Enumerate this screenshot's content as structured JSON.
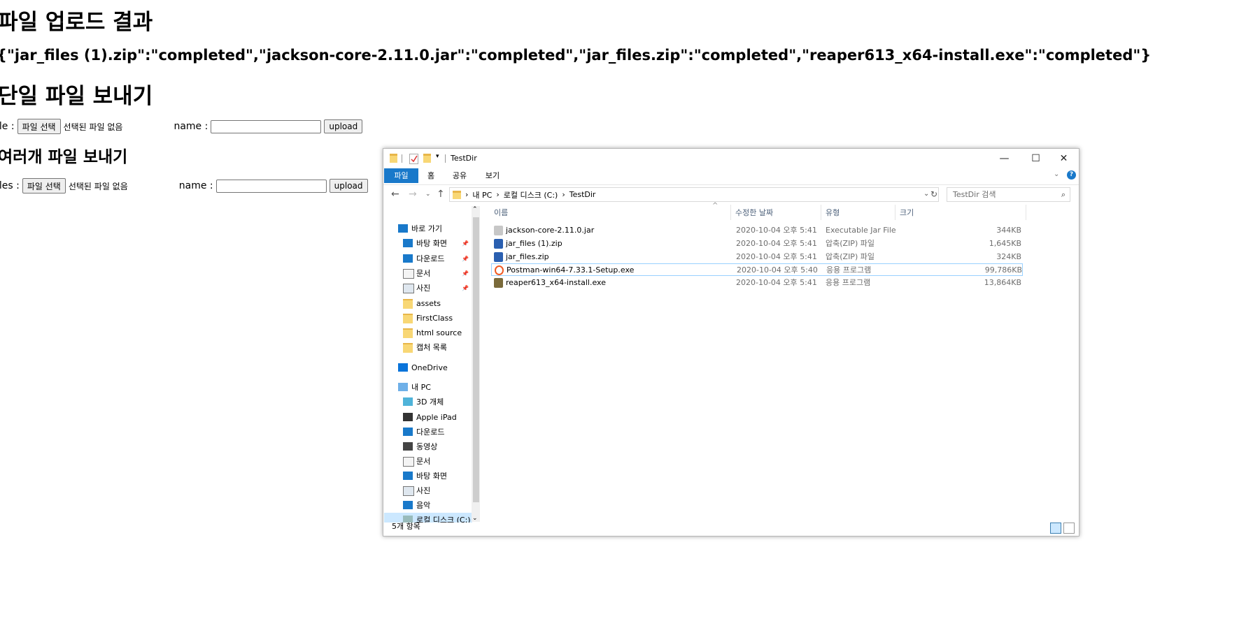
{
  "page": {
    "result_heading": "파일 업로드 결과",
    "result_json": "{\"jar_files (1).zip\":\"completed\",\"jackson-core-2.11.0.jar\":\"completed\",\"jar_files.zip\":\"completed\",\"reaper613_x64-install.exe\":\"completed\"}",
    "single_heading": "단일 파일 보내기",
    "single_form": {
      "file_label": "ile :",
      "choose_button": "파일 선택",
      "no_file": "선택된 파일 없음",
      "name_label": "name :",
      "upload_button": "upload"
    },
    "multi_heading": "여러개 파일 보내기",
    "multi_form": {
      "file_label": "iles :",
      "choose_button": "파일 선택",
      "no_file": "선택된 파일 없음",
      "name_label": "name :",
      "upload_button": "upload"
    }
  },
  "explorer": {
    "title": "TestDir",
    "window_controls": {
      "minimize": "—",
      "maximize": "☐",
      "close": "✕"
    },
    "ribbon_tabs": [
      "파일",
      "홈",
      "공유",
      "보기"
    ],
    "address": {
      "sep": "›",
      "parts": [
        "내 PC",
        "로컬 디스크 (C:)",
        "TestDir"
      ]
    },
    "search_placeholder": "TestDir 검색",
    "nav": [
      {
        "label": "바로 가기",
        "icon": "star-icon"
      },
      {
        "label": "바탕 화면",
        "icon": "desktop-icon",
        "pinned": true
      },
      {
        "label": "다운로드",
        "icon": "download-icon",
        "pinned": true
      },
      {
        "label": "문서",
        "icon": "document-icon",
        "pinned": true
      },
      {
        "label": "사진",
        "icon": "pictures-icon",
        "pinned": true
      },
      {
        "label": "assets",
        "icon": "folder-icon"
      },
      {
        "label": "FirstClass",
        "icon": "folder-icon"
      },
      {
        "label": "html source",
        "icon": "folder-icon"
      },
      {
        "label": "캡처 목록",
        "icon": "folder-icon"
      },
      {
        "label": "OneDrive",
        "icon": "cloud-icon"
      },
      {
        "label": "내 PC",
        "icon": "pc-icon"
      },
      {
        "label": "3D 개체",
        "icon": "cube-icon"
      },
      {
        "label": "Apple iPad",
        "icon": "device-icon"
      },
      {
        "label": "다운로드",
        "icon": "download-icon"
      },
      {
        "label": "동영상",
        "icon": "video-icon"
      },
      {
        "label": "문서",
        "icon": "document-icon"
      },
      {
        "label": "바탕 화면",
        "icon": "desktop-icon"
      },
      {
        "label": "사진",
        "icon": "pictures-icon"
      },
      {
        "label": "음악",
        "icon": "music-icon"
      },
      {
        "label": "로컬 디스크 (C:)",
        "icon": "drive-icon",
        "selected": true
      }
    ],
    "columns": {
      "name": "이름",
      "date": "수정한 날짜",
      "type": "유형",
      "size": "크기"
    },
    "files": [
      {
        "name": "jackson-core-2.11.0.jar",
        "date": "2020-10-04 오후 5:41",
        "type": "Executable Jar File",
        "size": "344KB",
        "icon": "jar-icon",
        "icon_color": "#c7c7c7"
      },
      {
        "name": "jar_files (1).zip",
        "date": "2020-10-04 오후 5:41",
        "type": "압축(ZIP) 파일",
        "size": "1,645KB",
        "icon": "zip-icon",
        "icon_color": "#2a5fb0"
      },
      {
        "name": "jar_files.zip",
        "date": "2020-10-04 오후 5:41",
        "type": "압축(ZIP) 파일",
        "size": "324KB",
        "icon": "zip-icon",
        "icon_color": "#2a5fb0"
      },
      {
        "name": "Postman-win64-7.33.1-Setup.exe",
        "date": "2020-10-04 오후 5:40",
        "type": "응용 프로그램",
        "size": "99,786KB",
        "icon": "postman-icon",
        "icon_color": "#ef5b25",
        "selected": true
      },
      {
        "name": "reaper613_x64-install.exe",
        "date": "2020-10-04 오후 5:41",
        "type": "응용 프로그램",
        "size": "13,864KB",
        "icon": "installer-icon",
        "icon_color": "#7a6a3a"
      }
    ],
    "status": "5개 항목"
  }
}
